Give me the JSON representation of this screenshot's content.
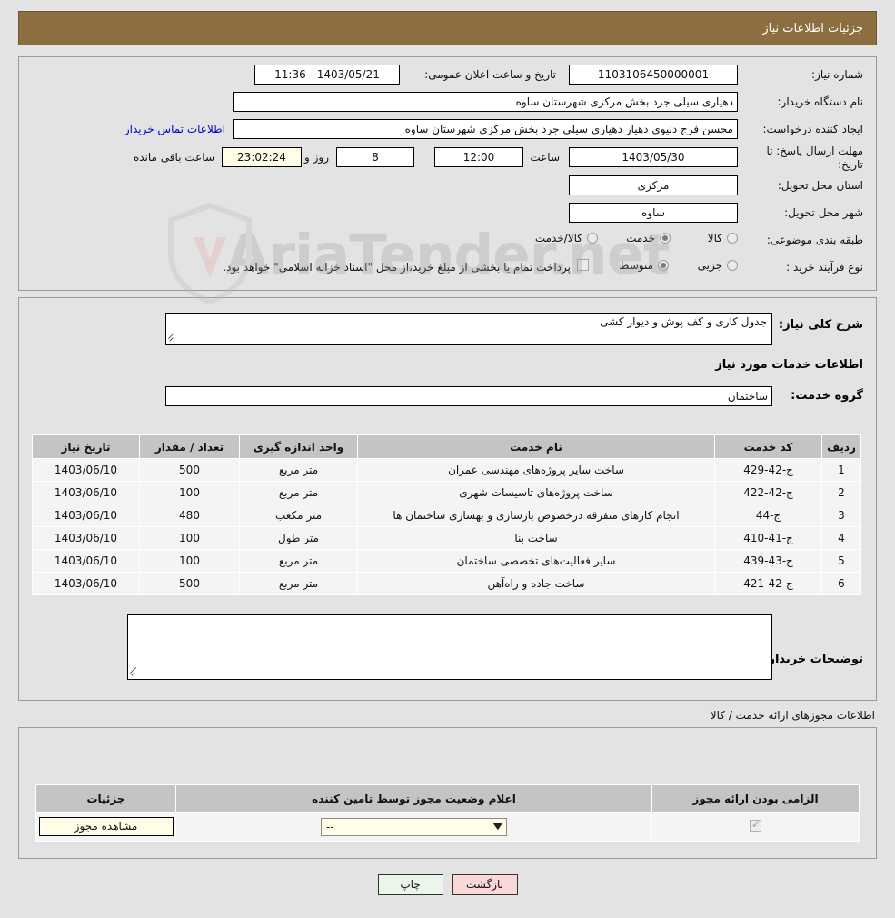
{
  "header": {
    "title": "جزئیات اطلاعات نیاز"
  },
  "main_form": {
    "need_number_label": "شماره نیاز:",
    "need_number_value": "1103106450000001",
    "announce_label": "تاریخ و ساعت اعلان عمومی:",
    "announce_value": "1403/05/21 - 11:36",
    "buyer_org_label": "نام دستگاه خریدار:",
    "buyer_org_value": "دهیاری سیلی جرد بخش مرکزی شهرستان ساوه",
    "creator_label": "ایجاد کننده درخواست:",
    "creator_value": "محسن فرج دنیوی دهیار دهیاری سیلی جرد بخش مرکزی شهرستان ساوه",
    "contact_link": "اطلاعات تماس خریدار",
    "deadline_label": "مهلت ارسال پاسخ: تا تاریخ:",
    "deadline_date": "1403/05/30",
    "hour_label": "ساعت",
    "hour_value": "12:00",
    "days_value": "8",
    "days_label": "روز و",
    "timer_value": "23:02:24",
    "remaining_label": "ساعت باقی مانده",
    "province_label": "استان محل تحویل:",
    "province_value": "مرکزی",
    "city_label": "شهر محل تحویل:",
    "city_value": "ساوه",
    "category_label": "طبقه بندی موضوعی:",
    "category_options": [
      {
        "label": "کالا",
        "selected": false
      },
      {
        "label": "خدمت",
        "selected": true
      },
      {
        "label": "کالا/خدمت",
        "selected": false
      }
    ],
    "process_label": "نوع فرآیند خرید :",
    "process_options": [
      {
        "label": "جزیی",
        "selected": false
      },
      {
        "label": "متوسط",
        "selected": true
      }
    ],
    "payment_note": "پرداخت تمام یا بخشی از مبلغ خرید،از محل \"اسناد خزانه اسلامی\" خواهد بود."
  },
  "detail": {
    "summary_label": "شرح کلی نیاز:",
    "summary_value": "جدول کاری و کف پوش و دیوار کشی",
    "services_info_heading": "اطلاعات خدمات مورد نیاز",
    "service_group_label": "گروه خدمت:",
    "service_group_value": "ساختمان",
    "buyer_notes_label": "توضیحات خریدار:",
    "buyer_notes_value": ""
  },
  "services_table": {
    "columns": [
      "ردیف",
      "کد خدمت",
      "نام خدمت",
      "واحد اندازه گیری",
      "تعداد / مقدار",
      "تاریخ نیاز"
    ],
    "rows": [
      {
        "row": "1",
        "code": "ج-42-429",
        "name": "ساخت سایر پروژه‌های مهندسی عمران",
        "unit": "متر مربع",
        "qty": "500",
        "date": "1403/06/10"
      },
      {
        "row": "2",
        "code": "ج-42-422",
        "name": "ساخت پروژه‌های تاسیسات شهری",
        "unit": "متر مربع",
        "qty": "100",
        "date": "1403/06/10"
      },
      {
        "row": "3",
        "code": "ج-44",
        "name": "انجام کارهای متفرقه درخصوص بازسازی و بهسازی ساختمان ها",
        "unit": "متر مکعب",
        "qty": "480",
        "date": "1403/06/10"
      },
      {
        "row": "4",
        "code": "ج-41-410",
        "name": "ساخت بنا",
        "unit": "متر طول",
        "qty": "100",
        "date": "1403/06/10"
      },
      {
        "row": "5",
        "code": "ج-43-439",
        "name": "سایر فعالیت‌های تخصصی ساختمان",
        "unit": "متر مربع",
        "qty": "100",
        "date": "1403/06/10"
      },
      {
        "row": "6",
        "code": "ج-42-421",
        "name": "ساخت جاده و راه‌آهن",
        "unit": "متر مربع",
        "qty": "500",
        "date": "1403/06/10"
      }
    ]
  },
  "licenses": {
    "section_caption": "اطلاعات مجوزهای ارائه خدمت / کالا",
    "columns": [
      "الزامی بودن ارائه مجوز",
      "اعلام وضعیت مجوز توسط تامین کننده",
      "جزئیات"
    ],
    "row": {
      "required_checked": true,
      "status_value": "--",
      "details_button": "مشاهده مجوز"
    }
  },
  "footer": {
    "print_label": "چاپ",
    "back_label": "بازگشت"
  },
  "watermark": {
    "text": "AriaTender.net"
  },
  "colors": {
    "header_brown": "#8d6e41",
    "panel_bg": "#e3e3e3",
    "table_header": "#c4c4c4",
    "link_blue": "#0000cc",
    "cream_field": "#fffde8",
    "print_green": "#eaf6ea",
    "back_pink": "#fbd8d8"
  }
}
